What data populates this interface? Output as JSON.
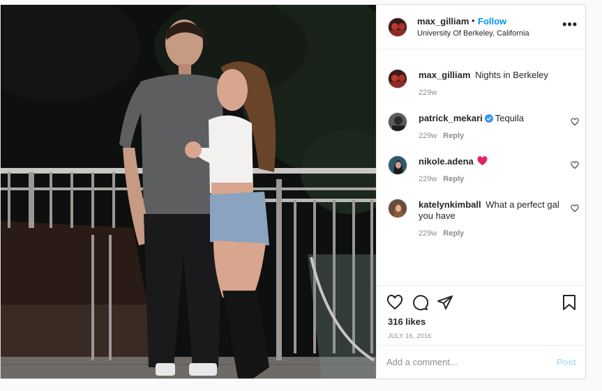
{
  "post": {
    "author": "max_gilliam",
    "separator": "•",
    "follow_label": "Follow",
    "location": "University Of Berkeley, California",
    "more_label": "•••"
  },
  "comments": [
    {
      "username": "max_gilliam",
      "text": "Nights in Berkeley",
      "age": "229w",
      "reply": "",
      "verified": false,
      "emoji": ""
    },
    {
      "username": "patrick_mekari",
      "text": "Tequila",
      "age": "229w",
      "reply": "Reply",
      "verified": true,
      "emoji": ""
    },
    {
      "username": "nikole.adena",
      "text": "",
      "age": "229w",
      "reply": "Reply",
      "verified": false,
      "emoji": "red-heart"
    },
    {
      "username": "katelynkimball",
      "text": "What a perfect gal you have",
      "age": "229w",
      "reply": "Reply",
      "verified": false,
      "emoji": ""
    }
  ],
  "actions": {
    "like_icon": "heart-outline-icon",
    "comment_icon": "speech-bubble-icon",
    "share_icon": "paper-plane-icon",
    "save_icon": "bookmark-icon"
  },
  "likes": "316 likes",
  "date": "JULY 16, 2016",
  "add_comment": {
    "placeholder": "Add a comment...",
    "post_label": "Post"
  },
  "colors": {
    "accent": "#0095f6",
    "post_disabled": "#b2dffc",
    "verified": "#3897f0",
    "heart": "#ed4956",
    "muted": "#8e8e8e"
  }
}
